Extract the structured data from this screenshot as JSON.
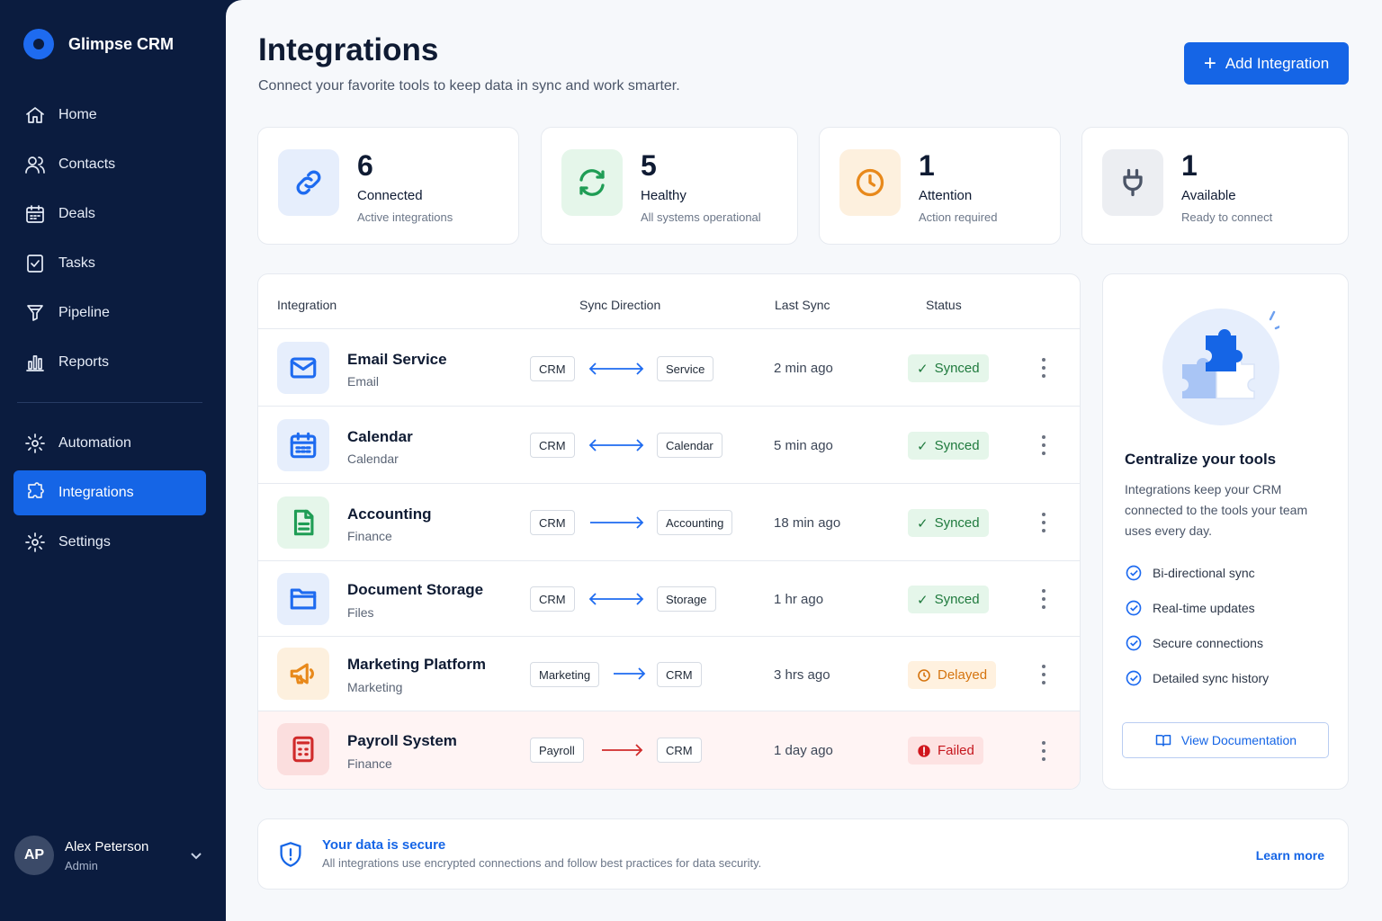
{
  "brand": {
    "name": "Glimpse CRM"
  },
  "nav": {
    "items": [
      {
        "label": "Home",
        "icon": "home-icon"
      },
      {
        "label": "Contacts",
        "icon": "users-icon"
      },
      {
        "label": "Deals",
        "icon": "calendar-icon"
      },
      {
        "label": "Tasks",
        "icon": "checklist-icon"
      },
      {
        "label": "Pipeline",
        "icon": "funnel-icon"
      },
      {
        "label": "Reports",
        "icon": "bar-chart-icon"
      }
    ],
    "secondary": [
      {
        "label": "Automation",
        "icon": "gear-icon"
      },
      {
        "label": "Integrations",
        "icon": "puzzle-icon",
        "active": true
      },
      {
        "label": "Settings",
        "icon": "gear-icon"
      }
    ]
  },
  "user": {
    "initials": "AP",
    "name": "Alex Peterson",
    "role": "Admin"
  },
  "header": {
    "title": "Integrations",
    "subtitle": "Connect your favorite tools to keep data in sync and work smarter.",
    "add_button": "Add Integration"
  },
  "stats": [
    {
      "value": "6",
      "label": "Connected",
      "desc": "Active integrations",
      "icon": "link-icon",
      "color": "#1e6bf0"
    },
    {
      "value": "5",
      "label": "Healthy",
      "desc": "All systems operational",
      "icon": "sync-icon",
      "color": "#1f9d55"
    },
    {
      "value": "1",
      "label": "Attention",
      "desc": "Action required",
      "icon": "clock-icon",
      "color": "#e8891b"
    },
    {
      "value": "1",
      "label": "Available",
      "desc": "Ready to connect",
      "icon": "plug-icon",
      "color": "#4b5567"
    }
  ],
  "table": {
    "headers": {
      "integration": "Integration",
      "sync_direction": "Sync Direction",
      "last_sync": "Last Sync",
      "status": "Status"
    },
    "rows": [
      {
        "name": "Email Service",
        "category": "Email",
        "from": "CRM",
        "to": "Service",
        "bidirectional": true,
        "last_sync": "2 min ago",
        "status": "Synced",
        "icon": "mail-icon"
      },
      {
        "name": "Calendar",
        "category": "Calendar",
        "from": "CRM",
        "to": "Calendar",
        "bidirectional": true,
        "last_sync": "5 min ago",
        "status": "Synced",
        "icon": "calendar-icon"
      },
      {
        "name": "Accounting",
        "category": "Finance",
        "from": "CRM",
        "to": "Accounting",
        "bidirectional": false,
        "last_sync": "18 min ago",
        "status": "Synced",
        "icon": "document-icon"
      },
      {
        "name": "Document Storage",
        "category": "Files",
        "from": "CRM",
        "to": "Storage",
        "bidirectional": true,
        "last_sync": "1 hr ago",
        "status": "Synced",
        "icon": "folder-icon"
      },
      {
        "name": "Marketing Platform",
        "category": "Marketing",
        "from": "Marketing",
        "to": "CRM",
        "bidirectional": false,
        "last_sync": "3 hrs ago",
        "status": "Delayed",
        "icon": "megaphone-icon"
      },
      {
        "name": "Payroll System",
        "category": "Finance",
        "from": "Payroll",
        "to": "CRM",
        "bidirectional": false,
        "last_sync": "1 day ago",
        "status": "Failed",
        "icon": "calculator-icon"
      }
    ]
  },
  "side_card": {
    "title": "Centralize your tools",
    "text": "Integrations keep your CRM connected to the tools your team uses every day.",
    "features": [
      "Bi-directional sync",
      "Real-time updates",
      "Secure connections",
      "Detailed sync history"
    ],
    "button": "View Documentation"
  },
  "security": {
    "title": "Your data is secure",
    "desc": "All integrations use encrypted connections and follow best practices for data security.",
    "link": "Learn more"
  },
  "colors": {
    "accent": "#1565e6",
    "sidebar": "#0b1c3f",
    "synced": "#1f7a3d",
    "delayed": "#d5740f",
    "failed": "#c5161d"
  }
}
